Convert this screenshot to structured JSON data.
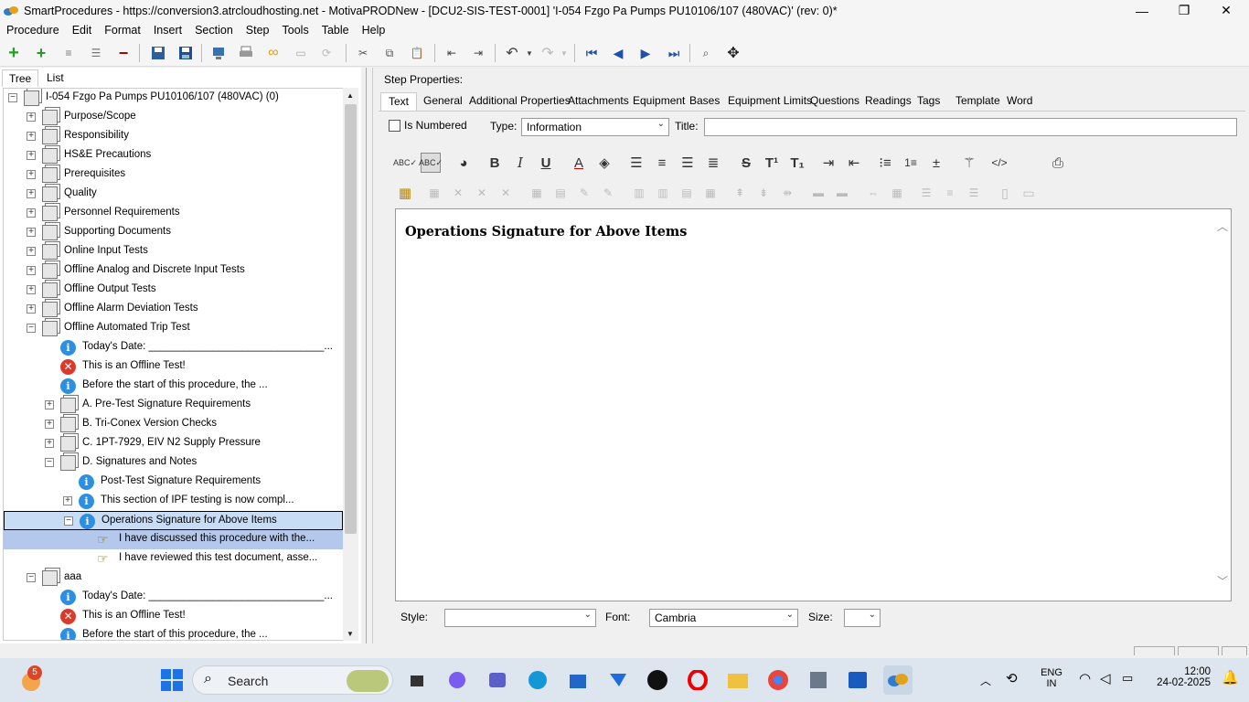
{
  "window": {
    "title": "SmartProcedures - https://conversion3.atrcloudhosting.net - MotivaPRODNew - [DCU2-SIS-TEST-0001] 'I-054 Fzgo Pa Pumps PU10106/107 (480VAC)' (rev: 0)*",
    "minimize": "—",
    "restore": "❐",
    "close": "✕"
  },
  "menu": [
    "Procedure",
    "Edit",
    "Format",
    "Insert",
    "Section",
    "Step",
    "Tools",
    "Table",
    "Help"
  ],
  "left_tabs": [
    "Tree",
    "List"
  ],
  "tree": [
    {
      "label": "I-054 Fzgo Pa Pumps PU10106/107 (480VAC) (0)",
      "icon": "doc",
      "expander": "−",
      "indent": 0
    },
    {
      "label": "Purpose/Scope",
      "icon": "doc",
      "expander": "+",
      "indent": 1
    },
    {
      "label": "Responsibility",
      "icon": "doc",
      "expander": "+",
      "indent": 1
    },
    {
      "label": "HS&E Precautions",
      "icon": "doc",
      "expander": "+",
      "indent": 1
    },
    {
      "label": "Prerequisites",
      "icon": "doc",
      "expander": "+",
      "indent": 1
    },
    {
      "label": "Quality",
      "icon": "doc",
      "expander": "+",
      "indent": 1
    },
    {
      "label": "Personnel Requirements",
      "icon": "doc",
      "expander": "+",
      "indent": 1
    },
    {
      "label": "Supporting Documents",
      "icon": "doc",
      "expander": "+",
      "indent": 1
    },
    {
      "label": "Online Input Tests",
      "icon": "doc",
      "expander": "+",
      "indent": 1
    },
    {
      "label": "Offline Analog and Discrete Input Tests",
      "icon": "doc",
      "expander": "+",
      "indent": 1
    },
    {
      "label": "Offline Output Tests",
      "icon": "doc",
      "expander": "+",
      "indent": 1
    },
    {
      "label": "Offline Alarm Deviation Tests",
      "icon": "doc",
      "expander": "+",
      "indent": 1
    },
    {
      "label": "Offline Automated Trip Test",
      "icon": "doc",
      "expander": "−",
      "indent": 1
    },
    {
      "label": "Today's Date: ______________________________...",
      "icon": "info",
      "expander": "",
      "indent": 2
    },
    {
      "label": "This is an Offline Test!",
      "icon": "error",
      "expander": "",
      "indent": 2
    },
    {
      "label": "Before the start of this procedure, the ...",
      "icon": "info",
      "expander": "",
      "indent": 2
    },
    {
      "label": "A. Pre-Test Signature Requirements",
      "icon": "doc",
      "expander": "+",
      "indent": 2
    },
    {
      "label": "B. Tri-Conex Version Checks",
      "icon": "doc",
      "expander": "+",
      "indent": 2
    },
    {
      "label": "C. 1PT-7929, EIV N2 Supply Pressure",
      "icon": "doc",
      "expander": "+",
      "indent": 2
    },
    {
      "label": "D. Signatures and Notes",
      "icon": "doc",
      "expander": "−",
      "indent": 2
    },
    {
      "label": "Post-Test Signature Requirements",
      "icon": "info",
      "expander": "",
      "indent": 3
    },
    {
      "label": "This section of IPF testing is now compl...",
      "icon": "info",
      "expander": "+",
      "indent": 3
    },
    {
      "label": "Operations Signature for Above Items",
      "icon": "info",
      "expander": "−",
      "indent": 3,
      "state": "selected"
    },
    {
      "label": "I have discussed this procedure with the...",
      "icon": "hand",
      "expander": "",
      "indent": 4,
      "state": "highlight"
    },
    {
      "label": "I have reviewed this test document, asse...",
      "icon": "hand",
      "expander": "",
      "indent": 4
    },
    {
      "label": "aaa",
      "icon": "doc",
      "expander": "−",
      "indent": 1
    },
    {
      "label": "Today's Date: ______________________________...",
      "icon": "info",
      "expander": "",
      "indent": 2
    },
    {
      "label": "This is an Offline Test!",
      "icon": "error",
      "expander": "",
      "indent": 2
    },
    {
      "label": "Before the start of this procedure, the ...",
      "icon": "info",
      "expander": "",
      "indent": 2
    }
  ],
  "step_properties_label": "Step Properties:",
  "right_tabs": [
    "Text",
    "General",
    "Additional Properties",
    "Attachments",
    "Equipment",
    "Bases",
    "Equipment Limits",
    "Questions",
    "Readings",
    "Tags",
    "Template",
    "Word"
  ],
  "is_numbered_label": "Is Numbered",
  "type_label": "Type:",
  "type_value": "Information",
  "title_label": "Title:",
  "title_value": "",
  "editor_text": "Operations Signature for Above Items",
  "style_label": "Style:",
  "style_value": "",
  "font_label": "Font:",
  "font_value": "Cambria",
  "size_label": "Size:",
  "size_value": "",
  "format_buttons": {
    "bold": "B",
    "italic": "I",
    "underline": "U",
    "strike": "S",
    "superscript": "T¹",
    "subscript": "T₁",
    "code": "</>"
  },
  "taskbar": {
    "search_label": "Search",
    "notification_count": "5",
    "language_line1": "ENG",
    "language_line2": "IN",
    "time": "12:00",
    "date": "24-02-2025"
  },
  "colors": {
    "selected_row": "#c8dcf5",
    "highlight_row": "#b3c8ea",
    "accent": "#1f5fbf"
  }
}
